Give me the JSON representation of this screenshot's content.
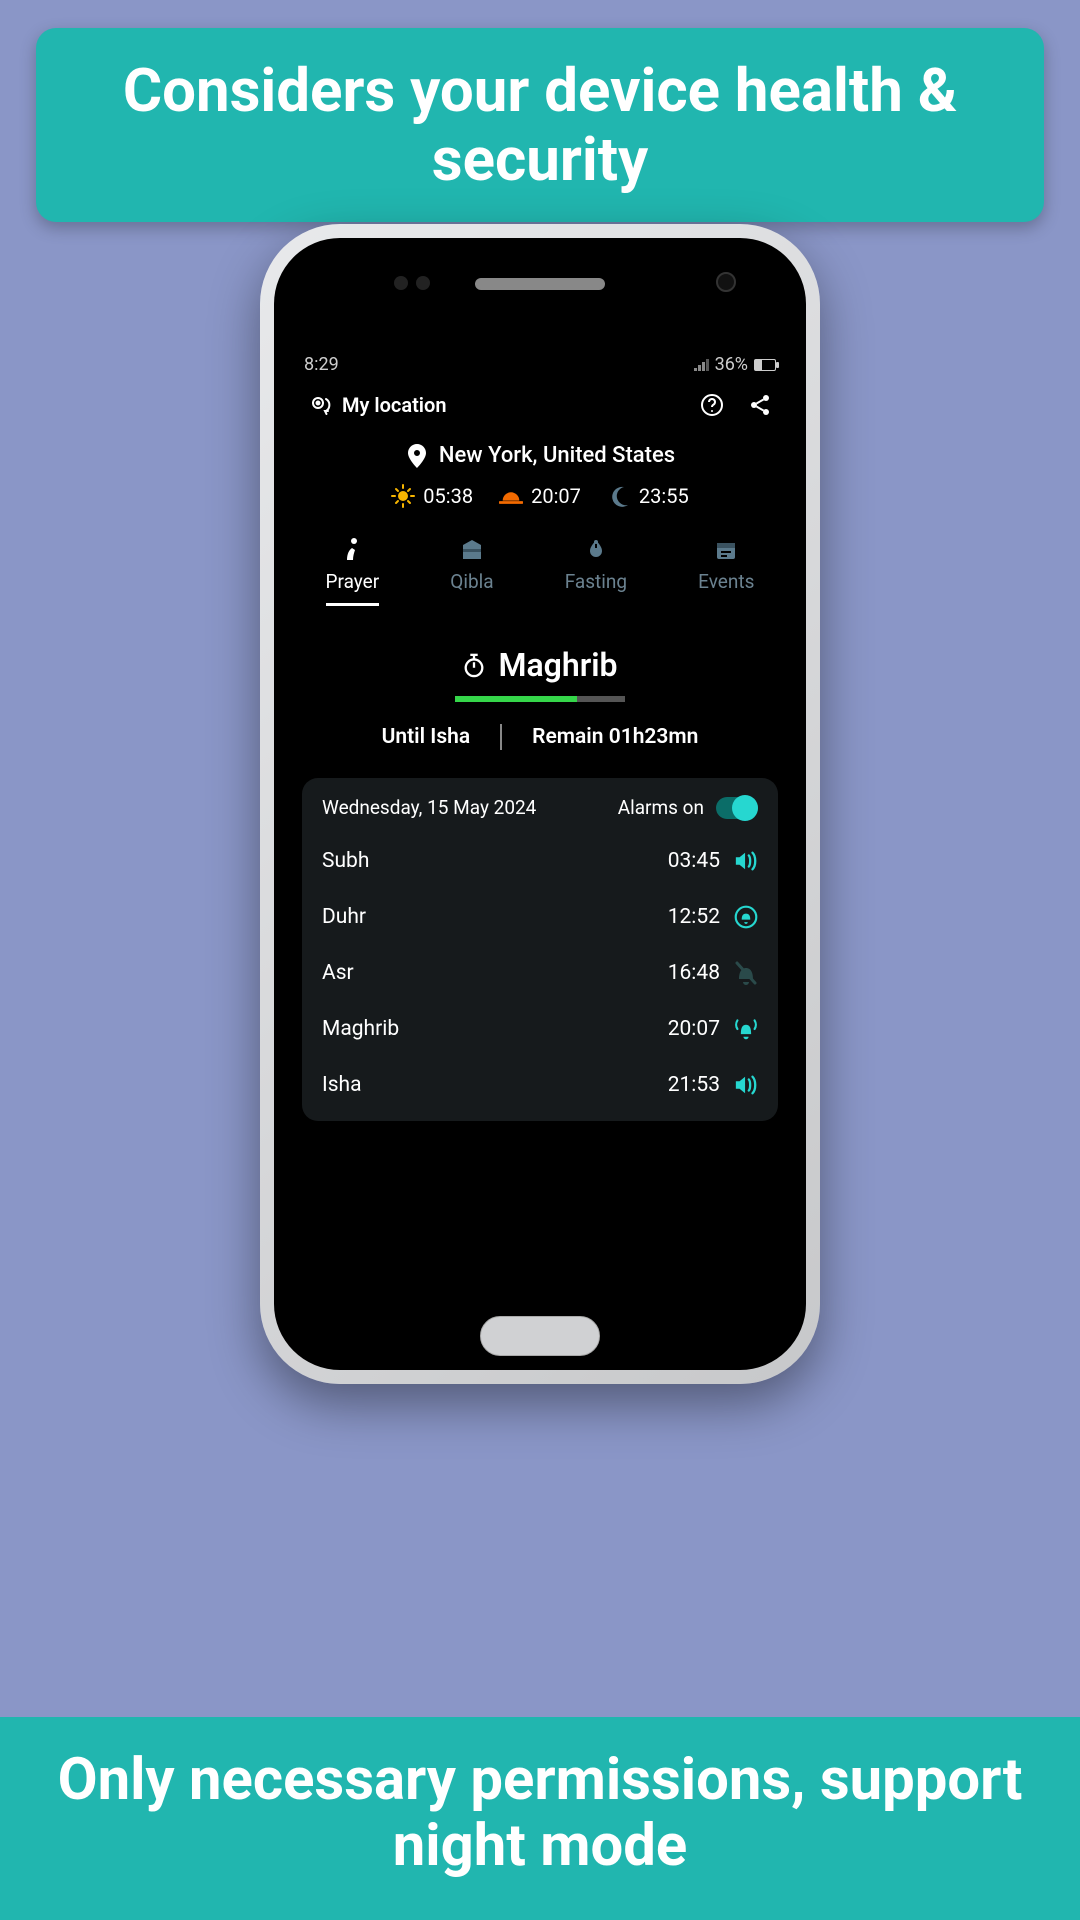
{
  "banners": {
    "top": "Considers your device health & security",
    "bottom": "Only necessary permissions, support night mode"
  },
  "status": {
    "time": "8:29",
    "battery": "36%"
  },
  "header": {
    "my_location": "My location"
  },
  "location": {
    "city": "New York, United States",
    "sunrise": "05:38",
    "sunset": "20:07",
    "night": "23:55"
  },
  "tabs": {
    "prayer": "Prayer",
    "qibla": "Qibla",
    "fasting": "Fasting",
    "events": "Events"
  },
  "current": {
    "name": "Maghrib",
    "until_label": "Until Isha",
    "remain_label": "Remain 01h23mn"
  },
  "panel": {
    "date": "Wednesday, 15 May 2024",
    "alarms_label": "Alarms on"
  },
  "prayers": {
    "subh": {
      "name": "Subh",
      "time": "03:45"
    },
    "duhr": {
      "name": "Duhr",
      "time": "12:52"
    },
    "asr": {
      "name": "Asr",
      "time": "16:48"
    },
    "maghrib": {
      "name": "Maghrib",
      "time": "20:07"
    },
    "isha": {
      "name": "Isha",
      "time": "21:53"
    }
  }
}
